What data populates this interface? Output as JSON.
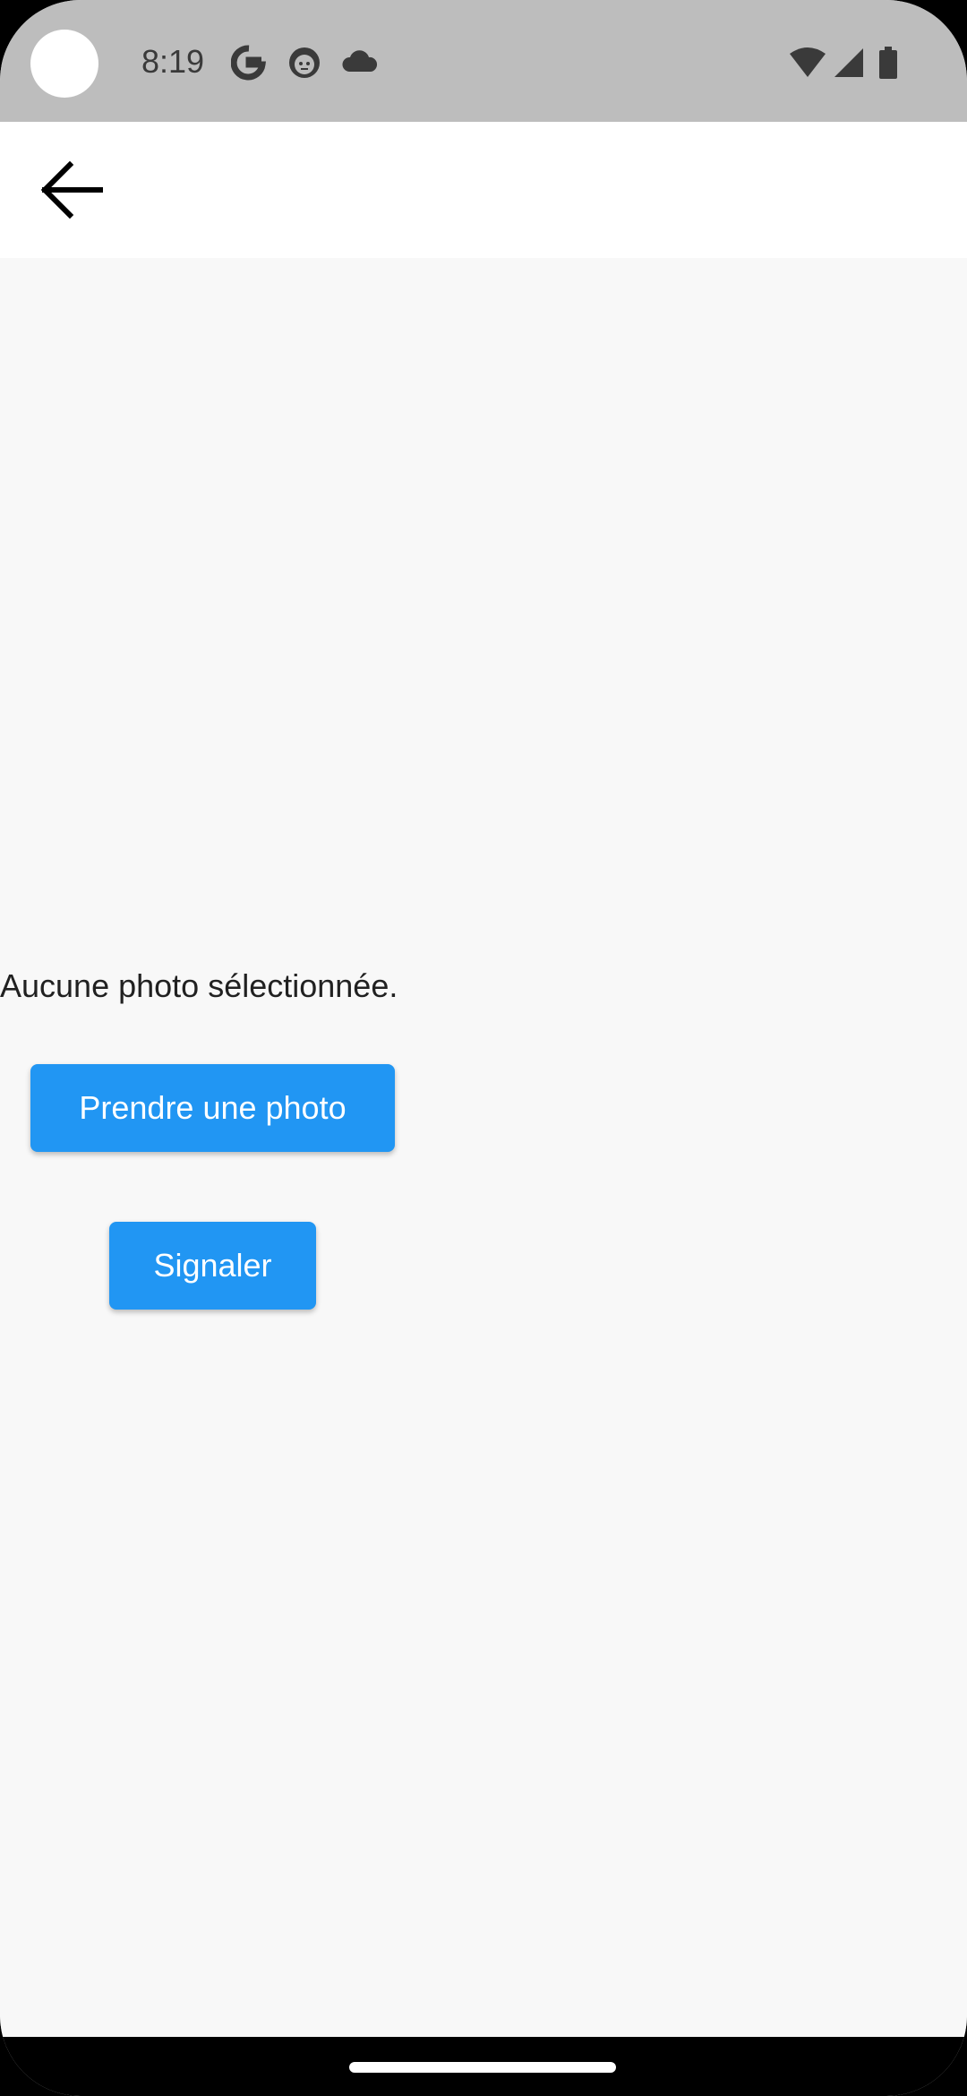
{
  "status_bar": {
    "time": "8:19",
    "icons": [
      "google-icon",
      "face-icon",
      "cloud-icon",
      "wifi-icon",
      "signal-icon",
      "battery-icon"
    ]
  },
  "app_bar": {
    "back_icon": "arrow-back-icon"
  },
  "main": {
    "no_photo_text": "Aucune photo sélectionnée.",
    "take_photo_label": "Prendre une photo",
    "report_label": "Signaler"
  },
  "colors": {
    "accent": "#2196f3",
    "status_bar_bg": "#bdbdbd",
    "background": "#f8f8f8"
  }
}
